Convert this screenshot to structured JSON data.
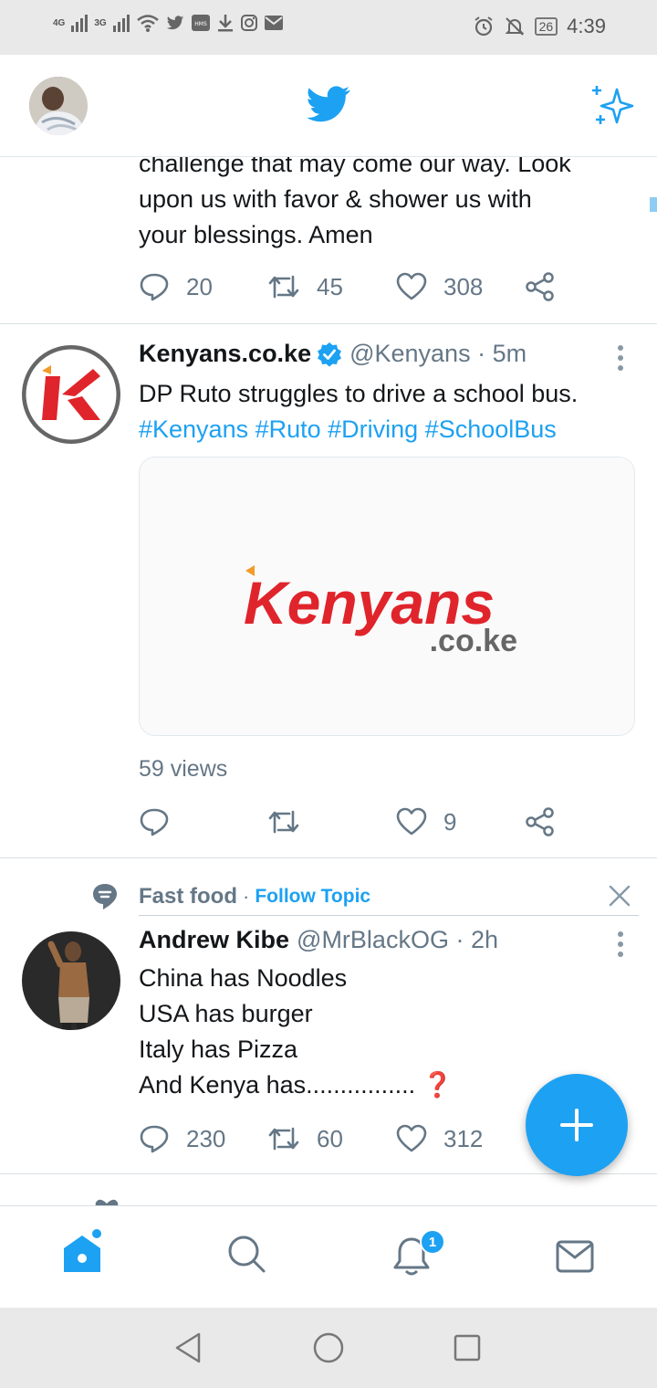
{
  "status_bar": {
    "network_1": "4G",
    "network_2": "3G",
    "battery": "26",
    "time": "4:39"
  },
  "header": {
    "logo_icon": "twitter-bird-icon",
    "sparkle_icon": "sparkle-icon"
  },
  "tweets": [
    {
      "text_lines": [
        "challenge that may come our way. Look",
        "upon us with favor & shower us with",
        "your blessings. Amen"
      ],
      "replies": "20",
      "retweets": "45",
      "likes": "308"
    },
    {
      "name": "Kenyans.co.ke",
      "handle": "@Kenyans · 5m",
      "text": "DP Ruto struggles to drive a school bus.",
      "hashtags": "#Kenyans #Ruto #Driving #SchoolBus",
      "media_logo_main": "Kenyans",
      "media_logo_sub": ".co.ke",
      "views": "59 views",
      "replies": "",
      "retweets": "",
      "likes": "9"
    },
    {
      "topic": "Fast food",
      "topic_sep": "·",
      "follow_topic": "Follow Topic",
      "name": "Andrew Kibe",
      "handle": "@MrBlackOG · 2h",
      "text_lines": [
        "China has Noodles",
        "USA has burger",
        "Italy has Pizza",
        "And Kenya has................"
      ],
      "emoji": "❓",
      "replies": "230",
      "retweets": "60",
      "likes": "312"
    }
  ],
  "notifications_badge": "1",
  "colors": {
    "accent": "#1da1f2",
    "text": "#14171a",
    "secondary": "#657786",
    "kenyans_red": "#e0242b"
  }
}
